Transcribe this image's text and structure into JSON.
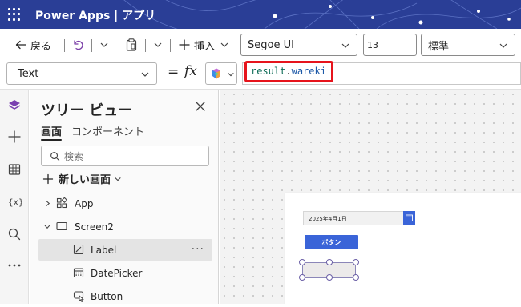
{
  "titlebar": {
    "app_title": "Power Apps | アプリ"
  },
  "toolbar": {
    "back_label": "戻る",
    "insert_label": "挿入",
    "font_family_value": "Segoe UI",
    "font_size_value": "13",
    "font_weight_value": "標準"
  },
  "formula_bar": {
    "property_value": "Text",
    "equals": "=",
    "fx": "fx",
    "formula_part1": "result",
    "formula_part2": ".",
    "formula_part3": "wareki"
  },
  "tree_view": {
    "title": "ツリー ビュー",
    "tabs": [
      {
        "label": "画面"
      },
      {
        "label": "コンポーネント"
      }
    ],
    "search_placeholder": "検索",
    "new_screen_label": "新しい画面",
    "items": [
      {
        "label": "App",
        "icon": "app-icon"
      },
      {
        "label": "Screen2",
        "icon": "screen-icon"
      },
      {
        "label": "Label",
        "icon": "label-edit-icon",
        "selected": true
      },
      {
        "label": "DatePicker",
        "icon": "calendar-icon"
      },
      {
        "label": "Button",
        "icon": "button-icon"
      }
    ],
    "more": "···"
  },
  "canvas": {
    "date_value": "2025年4月1日",
    "button_text": "ボタン"
  },
  "colors": {
    "titlebar_bg": "#2a3e96",
    "accent": "#3a64d8",
    "highlight_border": "#e6141c",
    "selection": "#6b5fa6"
  }
}
